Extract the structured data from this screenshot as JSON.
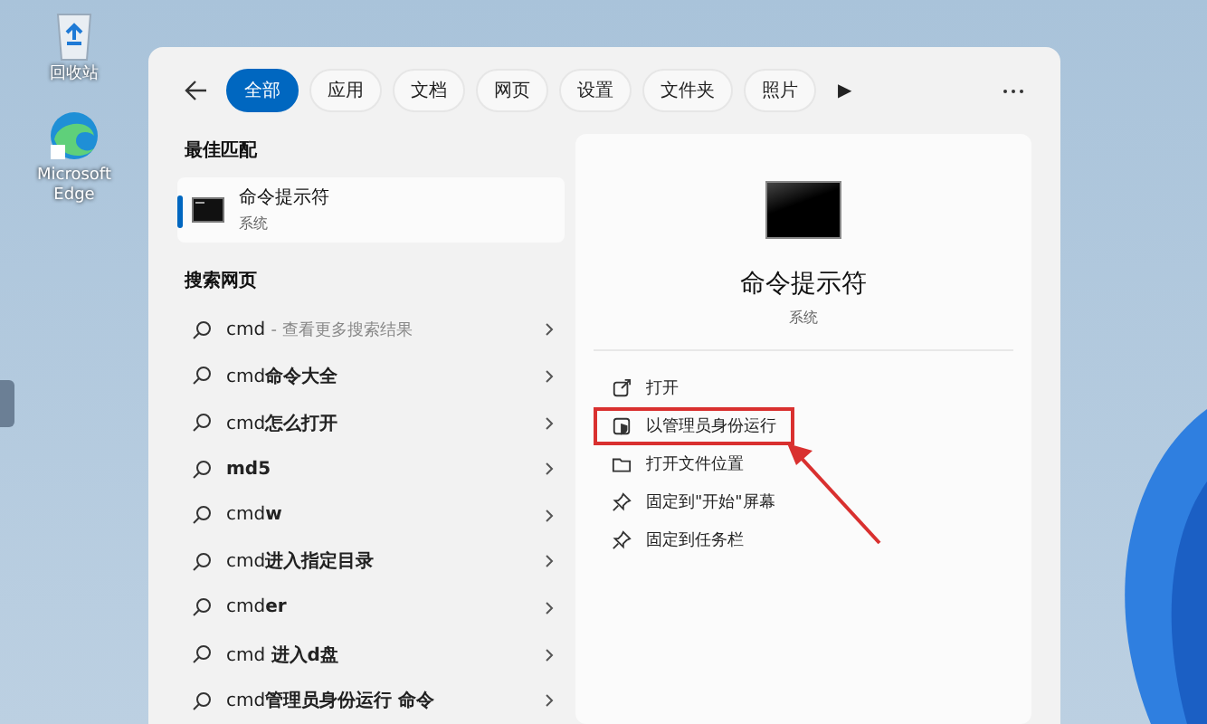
{
  "desktop_icons": [
    {
      "label": "回收站"
    },
    {
      "label": "Microsoft Edge"
    }
  ],
  "search_panel": {
    "tabs": [
      {
        "label": "全部",
        "selected": true
      },
      {
        "label": "应用",
        "selected": false
      },
      {
        "label": "文档",
        "selected": false
      },
      {
        "label": "网页",
        "selected": false
      },
      {
        "label": "设置",
        "selected": false
      },
      {
        "label": "文件夹",
        "selected": false
      },
      {
        "label": "照片",
        "selected": false
      }
    ],
    "more_tabs": "▶",
    "best_match": {
      "heading": "最佳匹配",
      "title": "命令提示符",
      "subtitle": "系统",
      "selected": true
    },
    "web_search": {
      "heading": "搜索网页",
      "results": [
        {
          "query": "cmd",
          "hint": "- 查看更多搜索结果"
        },
        {
          "query": "cmd**命令大全**"
        },
        {
          "query": "cmd**怎么打开**"
        },
        {
          "query": "**md5**"
        },
        {
          "query": "cmd**w**"
        },
        {
          "query": "cmd**进入指定目录**"
        },
        {
          "query": "cmd**er**"
        },
        {
          "query": "cmd **进入d盘**"
        },
        {
          "query": "cmd**管理员身份运行 命令**"
        }
      ]
    },
    "preview": {
      "title": "命令提示符",
      "subtitle": "系统",
      "actions": [
        {
          "kind": "open",
          "label": "打开",
          "highlighted": false
        },
        {
          "kind": "admin",
          "label": "以管理员身份运行",
          "highlighted": true
        },
        {
          "kind": "folder",
          "label": "打开文件位置",
          "highlighted": false
        },
        {
          "kind": "pin",
          "label": "固定到\"开始\"屏幕",
          "highlighted": false
        },
        {
          "kind": "pin",
          "label": "固定到任务栏",
          "highlighted": false
        }
      ]
    }
  }
}
